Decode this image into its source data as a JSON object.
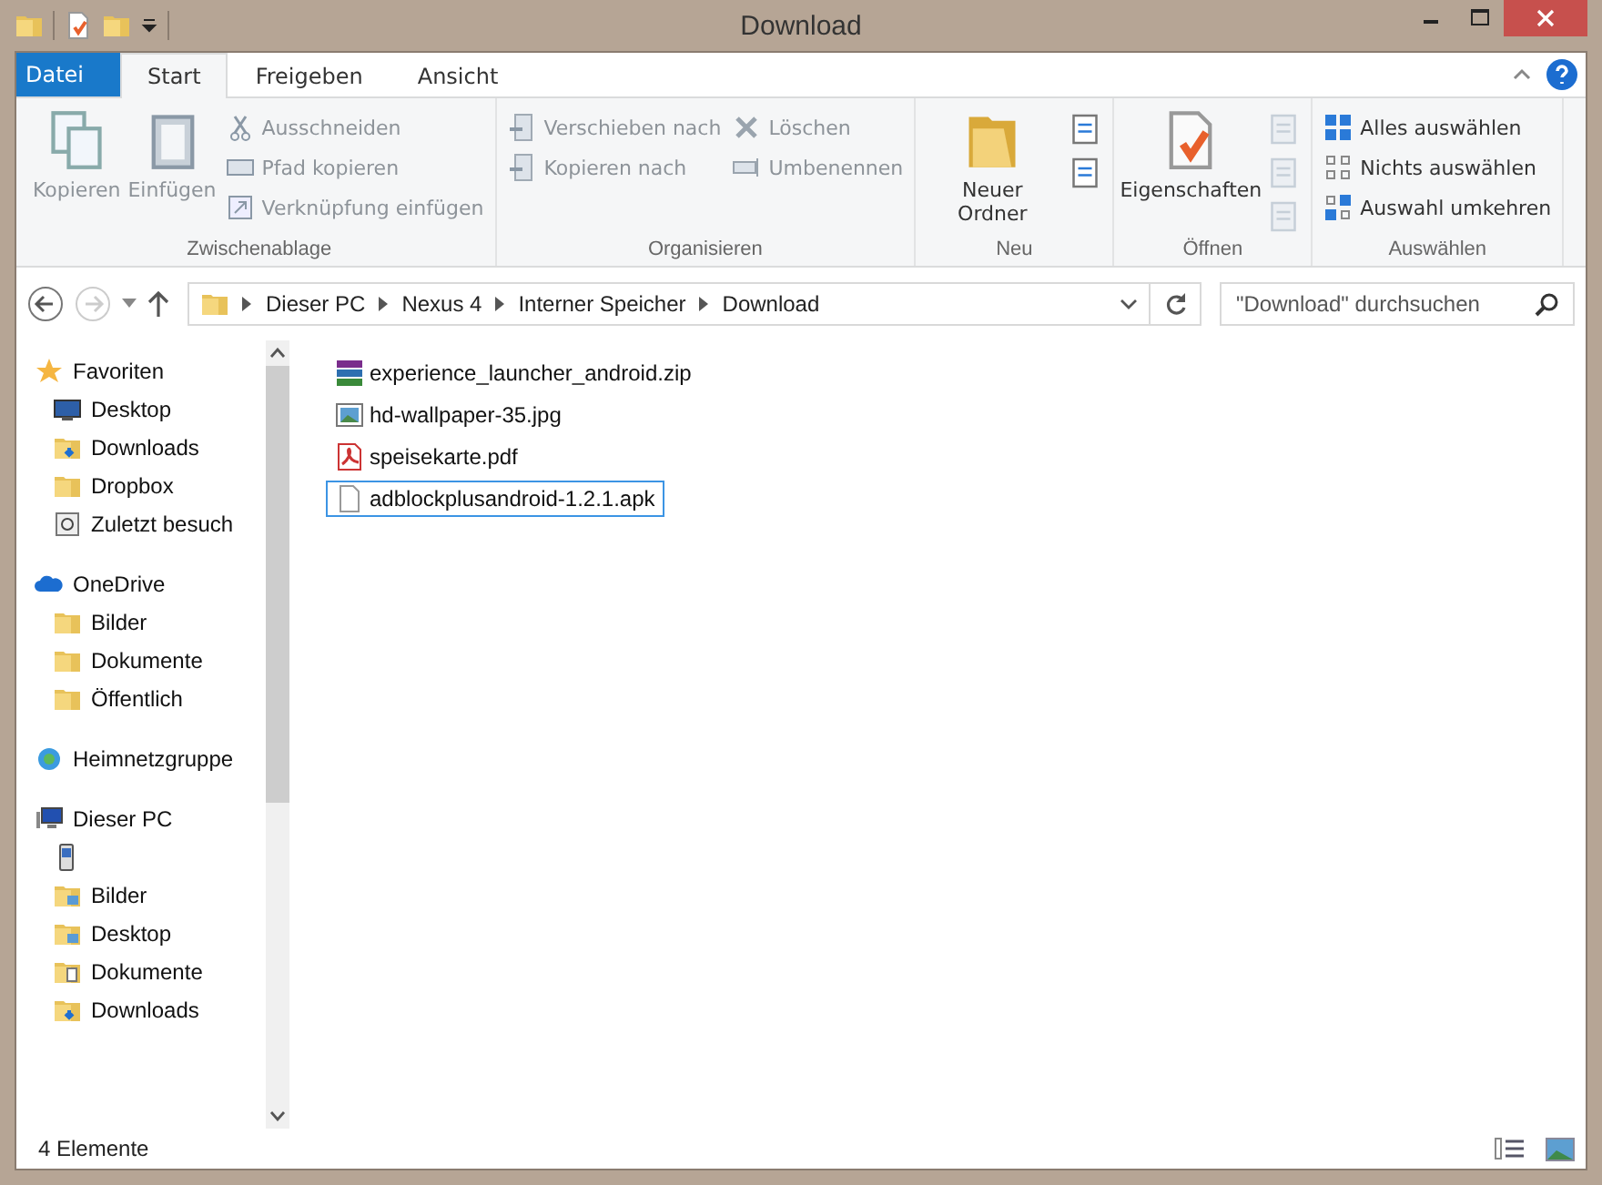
{
  "window": {
    "title": "Download"
  },
  "ribbon_tabs": [
    {
      "label": "Datei",
      "kind": "file",
      "selected": false
    },
    {
      "label": "Start",
      "kind": "tab",
      "selected": true
    },
    {
      "label": "Freigeben",
      "kind": "tab",
      "selected": false
    },
    {
      "label": "Ansicht",
      "kind": "tab",
      "selected": false
    }
  ],
  "ribbon_groups": [
    {
      "label": "Zwischenablage",
      "items": [
        {
          "kind": "large",
          "label": "Kopieren",
          "disabled": true
        },
        {
          "kind": "large",
          "label": "Einfügen",
          "disabled": true
        },
        {
          "kind": "stack",
          "items": [
            {
              "label": "Ausschneiden",
              "disabled": true
            },
            {
              "label": "Pfad kopieren",
              "disabled": true
            },
            {
              "label": "Verknüpfung einfügen",
              "disabled": true
            }
          ]
        }
      ]
    },
    {
      "label": "Organisieren",
      "items": [
        {
          "kind": "stack",
          "items": [
            {
              "label": "Verschieben nach",
              "disabled": true
            },
            {
              "label": "Kopieren nach",
              "disabled": true
            }
          ]
        },
        {
          "kind": "stack",
          "items": [
            {
              "label": "Löschen",
              "disabled": true
            },
            {
              "label": "Umbenennen",
              "disabled": true
            }
          ]
        }
      ]
    },
    {
      "label": "Neu",
      "items": [
        {
          "kind": "large",
          "label": "Neuer Ordner",
          "disabled": false
        },
        {
          "kind": "icons",
          "items": [
            {
              "disabled": false
            },
            {
              "disabled": false
            }
          ]
        }
      ]
    },
    {
      "label": "Öffnen",
      "items": [
        {
          "kind": "large",
          "label": "Eigenschaften",
          "disabled": false
        },
        {
          "kind": "icons",
          "items": [
            {
              "disabled": true
            },
            {
              "disabled": true
            },
            {
              "disabled": true
            }
          ]
        }
      ]
    },
    {
      "label": "Auswählen",
      "items": [
        {
          "kind": "stack",
          "items": [
            {
              "label": "Alles auswählen",
              "disabled": false
            },
            {
              "label": "Nichts auswählen",
              "disabled": false
            },
            {
              "label": "Auswahl umkehren",
              "disabled": false
            }
          ]
        }
      ]
    }
  ],
  "address_bar": {
    "path": [
      "Dieser PC",
      "Nexus 4",
      "Interner Speicher",
      "Download"
    ]
  },
  "search": {
    "placeholder": "\"Download\" durchsuchen"
  },
  "navigation": [
    {
      "label": "Favoriten",
      "kind": "star",
      "children": [
        {
          "label": "Desktop",
          "kind": "desktop"
        },
        {
          "label": "Downloads",
          "kind": "downloads"
        },
        {
          "label": "Dropbox",
          "kind": "folder"
        },
        {
          "label": "Zuletzt besuch",
          "kind": "recent"
        }
      ]
    },
    {
      "label": "OneDrive",
      "kind": "cloud",
      "children": [
        {
          "label": "Bilder",
          "kind": "folder"
        },
        {
          "label": "Dokumente",
          "kind": "folder"
        },
        {
          "label": "Öffentlich",
          "kind": "folder"
        }
      ]
    },
    {
      "label": "Heimnetzgruppe",
      "kind": "network"
    },
    {
      "label": "Dieser PC",
      "kind": "pc",
      "children": [
        {
          "kind": "device"
        },
        {
          "label": "Bilder",
          "kind": "pictures"
        },
        {
          "label": "Desktop",
          "kind": "desktopfolder"
        },
        {
          "label": "Dokumente",
          "kind": "documents"
        },
        {
          "label": "Downloads",
          "kind": "downloads"
        }
      ]
    }
  ],
  "files": [
    {
      "name": "experience_launcher_android.zip",
      "kind": "zip",
      "selected": false
    },
    {
      "name": "hd-wallpaper-35.jpg",
      "kind": "image",
      "selected": false
    },
    {
      "name": "speisekarte.pdf",
      "kind": "pdf",
      "selected": false
    },
    {
      "name": "adblockplusandroid-1.2.1.apk",
      "kind": "file",
      "selected": true
    }
  ],
  "status_bar": {
    "count": "4 Elemente"
  }
}
